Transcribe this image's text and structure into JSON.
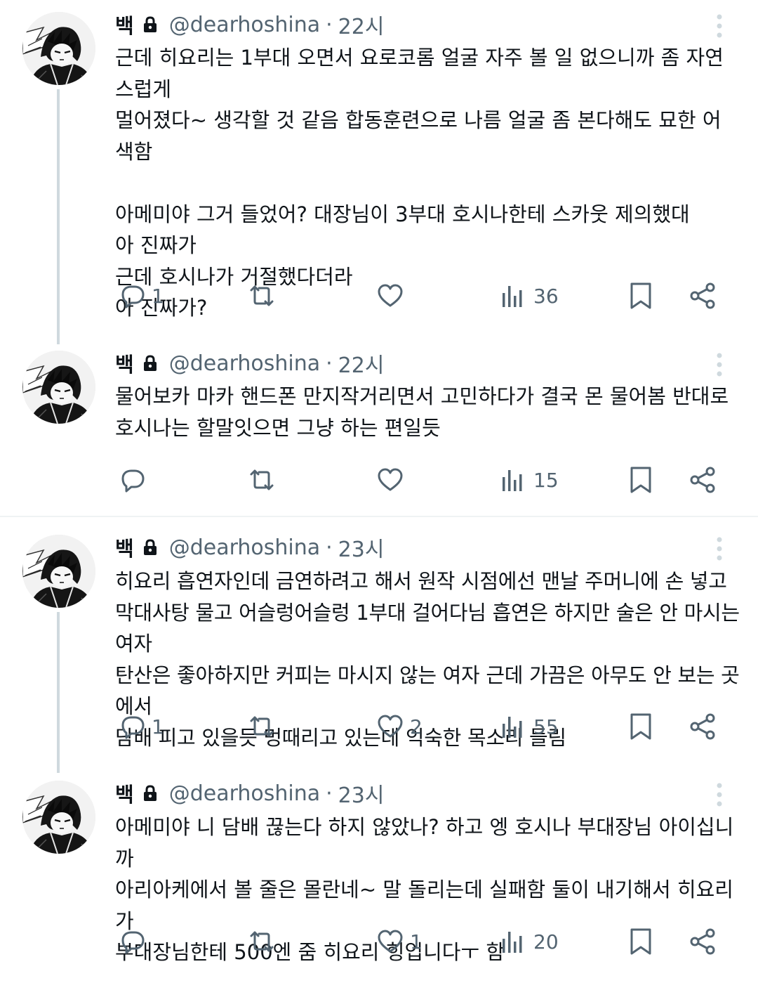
{
  "tweets": [
    {
      "name": "백",
      "handle": "@dearhoshina",
      "time": "22시",
      "text": "근데 히요리는 1부대 오면서 요로코롬 얼굴 자주 볼 일 없으니까 좀 자연스럽게\n멀어졌다~ 생각할 것 같음 합동훈련으로 나름 얼굴 좀 본다해도 묘한 어색함\n\n아메미야 그거 들었어? 대장님이 3부대 호시나한테 스카웃 제의했대\n아 진짜가\n근데 호시나가 거절했다더라\n아 진짜가?",
      "replies": "1",
      "retweets": "",
      "likes": "",
      "views": "36"
    },
    {
      "name": "백",
      "handle": "@dearhoshina",
      "time": "22시",
      "text": "물어보카 마카 핸드폰 만지작거리면서 고민하다가 결국 몬 물어봄 반대로\n호시나는 할말잇으면 그냥 하는 편일듯",
      "replies": "",
      "retweets": "",
      "likes": "",
      "views": "15"
    },
    {
      "name": "백",
      "handle": "@dearhoshina",
      "time": "23시",
      "text": "히요리 흡연자인데 금연하려고 해서 원작 시점에선 맨날 주머니에 손 넣고\n막대사탕 물고 어슬렁어슬렁 1부대 걸어다님 흡연은 하지만 술은 안 마시는 여자\n탄산은 좋아하지만 커피는 마시지 않는 여자 근데 가끔은 아무도 안 보는 곳에서\n담배 피고 있을듯 멍때리고 있는데 익숙한 목소리 들림",
      "replies": "1",
      "retweets": "",
      "likes": "2",
      "views": "55"
    },
    {
      "name": "백",
      "handle": "@dearhoshina",
      "time": "23시",
      "text": "아메미야 니 담배 끊는다 하지 않았나? 하고 엥 호시나 부대장님 아이십니까\n아리아케에서 볼 줄은 몰란네~ 말 돌리는데 실패함 둘이 내기해서 히요리가\n부대장님한테 500엔 줌 히요리 힝입니다ㅜ 함",
      "replies": "",
      "retweets": "",
      "likes": "1",
      "views": "20"
    }
  ],
  "separator_dot": "·"
}
